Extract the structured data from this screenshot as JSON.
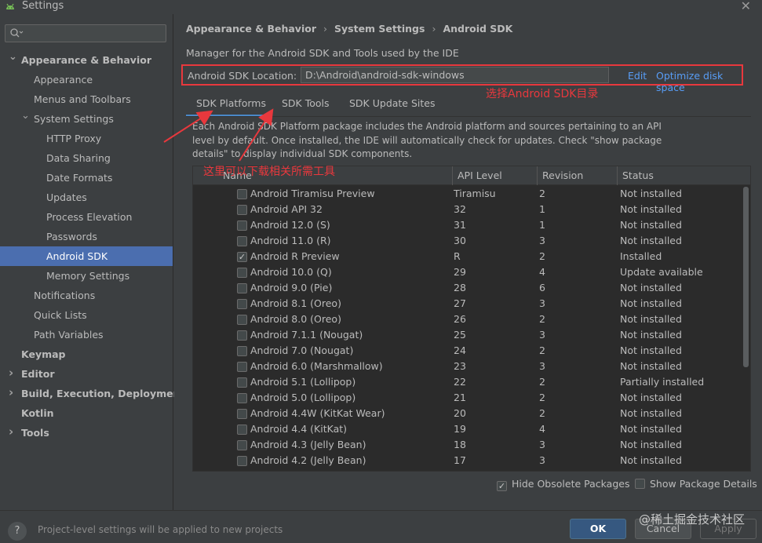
{
  "window": {
    "title": "Settings"
  },
  "search": {
    "placeholder": ""
  },
  "sidebar": {
    "items": [
      {
        "label": "Appearance & Behavior",
        "level": 0,
        "bold": true,
        "expanded": true
      },
      {
        "label": "Appearance",
        "level": 1
      },
      {
        "label": "Menus and Toolbars",
        "level": 1
      },
      {
        "label": "System Settings",
        "level": 1,
        "expanded": true
      },
      {
        "label": "HTTP Proxy",
        "level": 2
      },
      {
        "label": "Data Sharing",
        "level": 2
      },
      {
        "label": "Date Formats",
        "level": 2
      },
      {
        "label": "Updates",
        "level": 2
      },
      {
        "label": "Process Elevation",
        "level": 2
      },
      {
        "label": "Passwords",
        "level": 2
      },
      {
        "label": "Android SDK",
        "level": 2,
        "selected": true
      },
      {
        "label": "Memory Settings",
        "level": 2
      },
      {
        "label": "Notifications",
        "level": 1
      },
      {
        "label": "Quick Lists",
        "level": 1
      },
      {
        "label": "Path Variables",
        "level": 1
      },
      {
        "label": "Keymap",
        "level": 0,
        "bold": true
      },
      {
        "label": "Editor",
        "level": 0,
        "bold": true,
        "collapsed": true
      },
      {
        "label": "Build, Execution, Deployment",
        "level": 0,
        "bold": true,
        "collapsed": true
      },
      {
        "label": "Kotlin",
        "level": 0,
        "bold": true
      },
      {
        "label": "Tools",
        "level": 0,
        "bold": true,
        "collapsed": true
      }
    ]
  },
  "breadcrumb": [
    "Appearance & Behavior",
    "System Settings",
    "Android SDK"
  ],
  "description": "Manager for the Android SDK and Tools used by the IDE",
  "sdk_location": {
    "label": "Android SDK Location:",
    "value": "D:\\Android\\android-sdk-windows",
    "edit": "Edit",
    "optimize": "Optimize disk space"
  },
  "annotations": {
    "select_dir": "选择Android SDK目录",
    "download_tools": "这里可以下载相关所需工具"
  },
  "tabs": [
    {
      "label": "SDK Platforms",
      "active": true
    },
    {
      "label": "SDK Tools"
    },
    {
      "label": "SDK Update Sites"
    }
  ],
  "info_lines": [
    "Each Android SDK Platform package includes the Android platform and sources pertaining to an API",
    "level by default. Once installed, the IDE will automatically check for updates. Check \"show package",
    "details\" to display individual SDK components."
  ],
  "table": {
    "headers": [
      "Name",
      "API Level",
      "Revision",
      "Status"
    ],
    "rows": [
      {
        "checked": false,
        "name": "Android Tiramisu Preview",
        "api": "Tiramisu",
        "rev": "2",
        "status": "Not installed"
      },
      {
        "checked": false,
        "name": "Android API 32",
        "api": "32",
        "rev": "1",
        "status": "Not installed"
      },
      {
        "checked": false,
        "name": "Android 12.0 (S)",
        "api": "31",
        "rev": "1",
        "status": "Not installed"
      },
      {
        "checked": false,
        "name": "Android 11.0 (R)",
        "api": "30",
        "rev": "3",
        "status": "Not installed"
      },
      {
        "checked": true,
        "name": "Android R Preview",
        "api": "R",
        "rev": "2",
        "status": "Installed"
      },
      {
        "checked": false,
        "name": "Android 10.0 (Q)",
        "api": "29",
        "rev": "4",
        "status": "Update available"
      },
      {
        "checked": false,
        "name": "Android 9.0 (Pie)",
        "api": "28",
        "rev": "6",
        "status": "Not installed"
      },
      {
        "checked": false,
        "name": "Android 8.1 (Oreo)",
        "api": "27",
        "rev": "3",
        "status": "Not installed"
      },
      {
        "checked": false,
        "name": "Android 8.0 (Oreo)",
        "api": "26",
        "rev": "2",
        "status": "Not installed"
      },
      {
        "checked": false,
        "name": "Android 7.1.1 (Nougat)",
        "api": "25",
        "rev": "3",
        "status": "Not installed"
      },
      {
        "checked": false,
        "name": "Android 7.0 (Nougat)",
        "api": "24",
        "rev": "2",
        "status": "Not installed"
      },
      {
        "checked": false,
        "name": "Android 6.0 (Marshmallow)",
        "api": "23",
        "rev": "3",
        "status": "Not installed"
      },
      {
        "checked": false,
        "name": "Android 5.1 (Lollipop)",
        "api": "22",
        "rev": "2",
        "status": "Partially installed"
      },
      {
        "checked": false,
        "name": "Android 5.0 (Lollipop)",
        "api": "21",
        "rev": "2",
        "status": "Not installed"
      },
      {
        "checked": false,
        "name": "Android 4.4W (KitKat Wear)",
        "api": "20",
        "rev": "2",
        "status": "Not installed"
      },
      {
        "checked": false,
        "name": "Android 4.4 (KitKat)",
        "api": "19",
        "rev": "4",
        "status": "Not installed"
      },
      {
        "checked": false,
        "name": "Android 4.3 (Jelly Bean)",
        "api": "18",
        "rev": "3",
        "status": "Not installed"
      },
      {
        "checked": false,
        "name": "Android 4.2 (Jelly Bean)",
        "api": "17",
        "rev": "3",
        "status": "Not installed"
      }
    ]
  },
  "options": {
    "hide_obsolete": {
      "label": "Hide Obsolete Packages",
      "checked": true
    },
    "show_details": {
      "label": "Show Package Details",
      "checked": false
    }
  },
  "footer": {
    "help": "?",
    "text": "Project-level settings will be applied to new projects",
    "ok": "OK",
    "cancel": "Cancel",
    "apply": "Apply",
    "watermark": "@稀土掘金技术社区"
  },
  "colors": {
    "accent": "#4b6eaf",
    "link": "#589df6",
    "annotation": "#e8383d"
  }
}
